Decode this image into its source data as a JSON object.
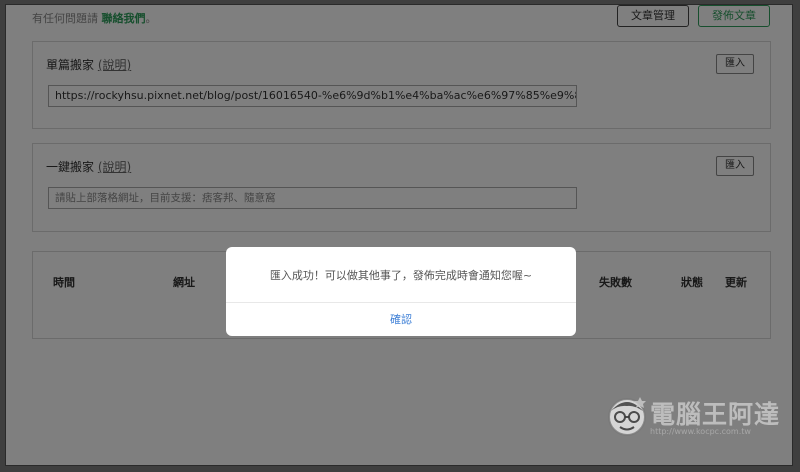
{
  "header": {
    "help_prefix": "有任何問題請",
    "help_link": "聯絡我們",
    "help_suffix": "。",
    "manage_button": "文章管理",
    "publish_button": "發佈文章"
  },
  "single_move": {
    "title": "單篇搬家",
    "explain_link": "(說明)",
    "import_button": "匯入",
    "url_value": "https://rockyhsu.pixnet.net/blog/post/16016540-%e6%9d%b1%e4%ba%ac%e6%97%85%e9%81%"
  },
  "bulk_move": {
    "title": "一鍵搬家",
    "explain_link": "(說明)",
    "import_button": "匯入",
    "placeholder": "請貼上部落格網址，目前支援：痞客邦、隨意窩"
  },
  "table": {
    "columns": [
      "時間",
      "網址",
      "失敗數",
      "狀態",
      "更新"
    ]
  },
  "modal": {
    "message": "匯入成功！可以做其他事了，發佈完成時會通知您喔~",
    "confirm": "確認"
  },
  "watermark": {
    "text": "電腦王阿達",
    "url": "http://www.kocpc.com.tw"
  },
  "colors": {
    "accent_green": "#2f9e5c",
    "link_blue": "#3d7fd6",
    "overlay": "rgba(0,0,0,0.5)"
  }
}
